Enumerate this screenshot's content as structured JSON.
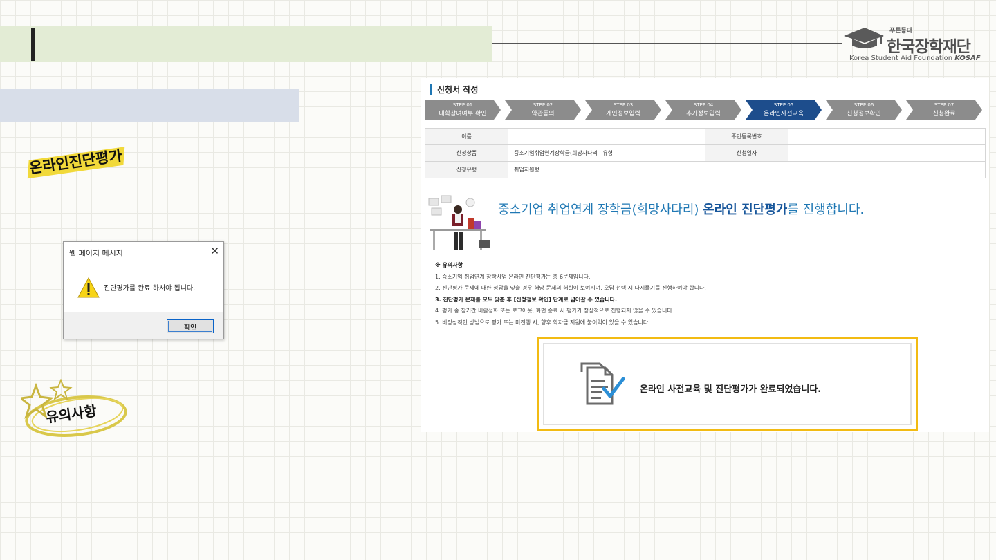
{
  "logo": {
    "tagline": "푸른등대",
    "name": "한국장학재단",
    "english": "Korea Student Aid Foundation",
    "abbr": "KOSAF"
  },
  "stickers": {
    "online_eval": "온라인진단평가",
    "notes": "유의사항"
  },
  "dialog": {
    "title": "웹 페이지 메시지",
    "close": "✕",
    "message": "진단평가를 완료 하셔야 됩니다.",
    "ok": "확인"
  },
  "panel": {
    "title": "신청서 작성",
    "steps": [
      {
        "num": "STEP 01",
        "label": "대학참여여부 확인"
      },
      {
        "num": "STEP 02",
        "label": "약관동의"
      },
      {
        "num": "STEP 03",
        "label": "개인정보입력"
      },
      {
        "num": "STEP 04",
        "label": "추가정보입력"
      },
      {
        "num": "STEP 05",
        "label": "온라인사전교육"
      },
      {
        "num": "STEP 06",
        "label": "신청정보확인"
      },
      {
        "num": "STEP 07",
        "label": "신청완료"
      }
    ],
    "info": {
      "name_label": "이름",
      "name_value": "",
      "rrn_label": "주민등록번호",
      "rrn_value": "",
      "product_label": "신청상품",
      "product_value": "중소기업취업연계장학금(희망사다리 I 유형",
      "date_label": "신청일자",
      "date_value": "",
      "type_label": "신청유형",
      "type_value": "취업지원형"
    },
    "heading_pre": "중소기업 취업연계 장학금(희망사다리) ",
    "heading_bold": "온라인 진단평가",
    "heading_post": "를 진행합니다.",
    "notes_title": "※ 유의사항",
    "notes": [
      "1. 중소기업 취업연계 장학사업 온라인 진단평가는 총 6문제입니다.",
      "2. 진단평가 문제에 대한 정답을 맞출 경우 해당 문제의 해설이 보여지며, 오답 선택 시 다시풀기를 진행하여야 합니다.",
      "3. 진단평가 문제를 모두 맞춘 후 [신청정보 확인] 단계로 넘어갈 수 있습니다.",
      "4. 평가 중 장기간 비활성화 또는 로그아웃, 화면 종료 시 평가가 정상적으로 진행되지 않을 수 있습니다.",
      "5. 비정상적인 방법으로 평가 또는 미진행 시, 향후 학자금 지원에 불이익이 있을 수 있습니다."
    ]
  },
  "done": {
    "message": "온라인 사전교육 및 진단평가가 완료되었습니다."
  },
  "colors": {
    "title_band": "#e3ecd5",
    "sub_band": "#d8dee9",
    "active_step": "#1d4d8c",
    "heading_blue": "#1f78b4",
    "highlight_border": "#f2bb13"
  }
}
